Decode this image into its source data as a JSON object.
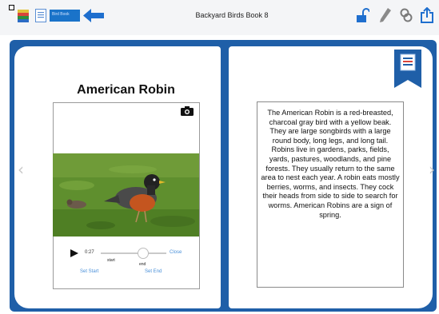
{
  "toolbar": {
    "book_title": "Backyard Birds Book 8",
    "active_tab_label": "Bird Book",
    "icons": [
      "menu-square-icon",
      "color-stack-icon",
      "page-thumbnail-icon",
      "back-arrow-icon",
      "unlock-icon",
      "pencil-icon",
      "link-icon",
      "share-icon"
    ]
  },
  "page": {
    "title": "American Robin",
    "photo_subject": "American Robin on grass",
    "body_text": "The American Robin is a red-breasted, charcoal gray bird with a yellow beak. They are large songbirds with a large round body, long legs, and long tail. Robins live in gardens, parks, fields, yards, pastures, woodlands, and pine forests. They usually return to the same area to nest each year. A robin eats mostly berries, worms, and insects. They cock their heads from side to side to search for worms. American Robins are a sign of spring."
  },
  "audio": {
    "time": "0:27",
    "start_label": "start",
    "end_label": "end",
    "close_label": "Close",
    "set_start_label": "Set Start",
    "set_end_label": "Set End"
  },
  "colors": {
    "cover": "#1f5fa8",
    "toolbar_blue": "#1a73c9",
    "link": "#4a90d9"
  }
}
